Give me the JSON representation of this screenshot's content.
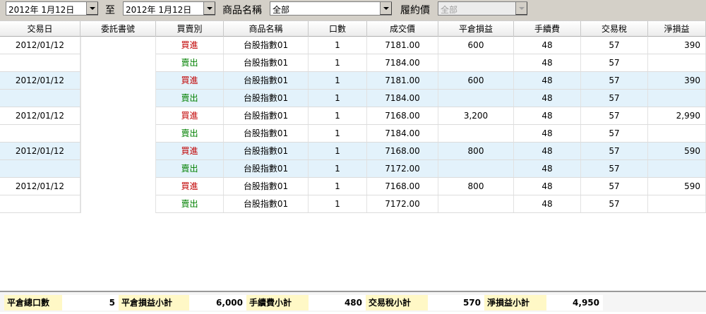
{
  "filters": {
    "date_from": "2012年  1月12日",
    "to_label": "至",
    "date_to": "2012年  1月12日",
    "product_label": "商品名稱",
    "product_value": "全部",
    "strike_label": "履約價",
    "strike_value": "全部"
  },
  "columns": [
    "交易日",
    "委託書號",
    "買賣別",
    "商品名稱",
    "口數",
    "成交價",
    "平倉損益",
    "手續費",
    "交易稅",
    "淨損益"
  ],
  "rows": [
    {
      "date": "2012/01/12",
      "side": "買進",
      "side_type": "buy",
      "product": "台股指數01",
      "qty": "1",
      "price": "7181.00",
      "pl": "600",
      "fee": "48",
      "tax": "57",
      "net": "390"
    },
    {
      "date": "",
      "side": "賣出",
      "side_type": "sell",
      "product": "台股指數01",
      "qty": "1",
      "price": "7184.00",
      "pl": "",
      "fee": "48",
      "tax": "57",
      "net": ""
    },
    {
      "date": "2012/01/12",
      "side": "買進",
      "side_type": "buy",
      "product": "台股指數01",
      "qty": "1",
      "price": "7181.00",
      "pl": "600",
      "fee": "48",
      "tax": "57",
      "net": "390"
    },
    {
      "date": "",
      "side": "賣出",
      "side_type": "sell",
      "product": "台股指數01",
      "qty": "1",
      "price": "7184.00",
      "pl": "",
      "fee": "48",
      "tax": "57",
      "net": ""
    },
    {
      "date": "2012/01/12",
      "side": "買進",
      "side_type": "buy",
      "product": "台股指數01",
      "qty": "1",
      "price": "7168.00",
      "pl": "3,200",
      "fee": "48",
      "tax": "57",
      "net": "2,990"
    },
    {
      "date": "",
      "side": "賣出",
      "side_type": "sell",
      "product": "台股指數01",
      "qty": "1",
      "price": "7184.00",
      "pl": "",
      "fee": "48",
      "tax": "57",
      "net": ""
    },
    {
      "date": "2012/01/12",
      "side": "買進",
      "side_type": "buy",
      "product": "台股指數01",
      "qty": "1",
      "price": "7168.00",
      "pl": "800",
      "fee": "48",
      "tax": "57",
      "net": "590"
    },
    {
      "date": "",
      "side": "賣出",
      "side_type": "sell",
      "product": "台股指數01",
      "qty": "1",
      "price": "7172.00",
      "pl": "",
      "fee": "48",
      "tax": "57",
      "net": ""
    },
    {
      "date": "2012/01/12",
      "side": "買進",
      "side_type": "buy",
      "product": "台股指數01",
      "qty": "1",
      "price": "7168.00",
      "pl": "800",
      "fee": "48",
      "tax": "57",
      "net": "590"
    },
    {
      "date": "",
      "side": "賣出",
      "side_type": "sell",
      "product": "台股指數01",
      "qty": "1",
      "price": "7172.00",
      "pl": "",
      "fee": "48",
      "tax": "57",
      "net": ""
    }
  ],
  "summary": {
    "close_qty_label": "平倉總口數",
    "close_qty": "5",
    "pl_label": "平倉損益小計",
    "pl": "6,000",
    "fee_label": "手續費小計",
    "fee": "480",
    "tax_label": "交易稅小計",
    "tax": "570",
    "net_label": "淨損益小計",
    "net": "4,950"
  },
  "colors": {
    "buy": "#c00000",
    "sell": "#008000",
    "highlight_row": "#e3f2fb",
    "summary_label_bg": "#fff8c6"
  },
  "icons": [
    "dropdown-arrow-icon"
  ]
}
